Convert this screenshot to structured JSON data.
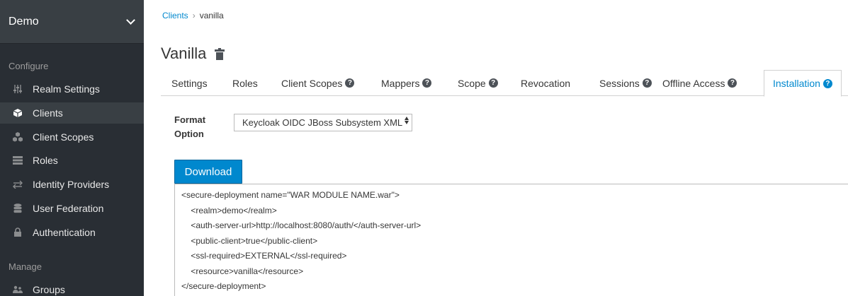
{
  "sidebar": {
    "realm": "Demo",
    "configure_title": "Configure",
    "manage_title": "Manage",
    "configure_items": [
      {
        "label": "Realm Settings",
        "icon": "sliders-icon"
      },
      {
        "label": "Clients",
        "icon": "cube-icon"
      },
      {
        "label": "Client Scopes",
        "icon": "cubes-icon"
      },
      {
        "label": "Roles",
        "icon": "list-icon"
      },
      {
        "label": "Identity Providers",
        "icon": "exchange-icon"
      },
      {
        "label": "User Federation",
        "icon": "database-icon"
      },
      {
        "label": "Authentication",
        "icon": "lock-icon"
      }
    ],
    "manage_items": [
      {
        "label": "Groups",
        "icon": "users-icon"
      }
    ],
    "active_item": "Clients"
  },
  "breadcrumb": {
    "parent": "Clients",
    "separator": "›",
    "current": "vanilla"
  },
  "page": {
    "title": "Vanilla"
  },
  "tabs": [
    {
      "label": "Settings",
      "help": false
    },
    {
      "label": "Roles",
      "help": false
    },
    {
      "label": "Client Scopes",
      "help": true
    },
    {
      "label": "Mappers",
      "help": true
    },
    {
      "label": "Scope",
      "help": true
    },
    {
      "label": "Revocation",
      "help": false
    },
    {
      "label": "Sessions",
      "help": true
    },
    {
      "label": "Offline Access",
      "help": true
    },
    {
      "label": "Installation",
      "help": true,
      "active": true
    }
  ],
  "form": {
    "format_label_line1": "Format",
    "format_label_line2": "Option",
    "format_value": "Keycloak OIDC JBoss Subsystem XML",
    "download_label": "Download"
  },
  "code_lines": [
    "<secure-deployment name=\"WAR MODULE NAME.war\">",
    "    <realm>demo</realm>",
    "    <auth-server-url>http://localhost:8080/auth/</auth-server-url>",
    "    <public-client>true</public-client>",
    "    <ssl-required>EXTERNAL</ssl-required>",
    "    <resource>vanilla</resource>",
    "</secure-deployment>"
  ],
  "colors": {
    "sidebar_bg": "#292e34",
    "accent": "#0088ce"
  }
}
